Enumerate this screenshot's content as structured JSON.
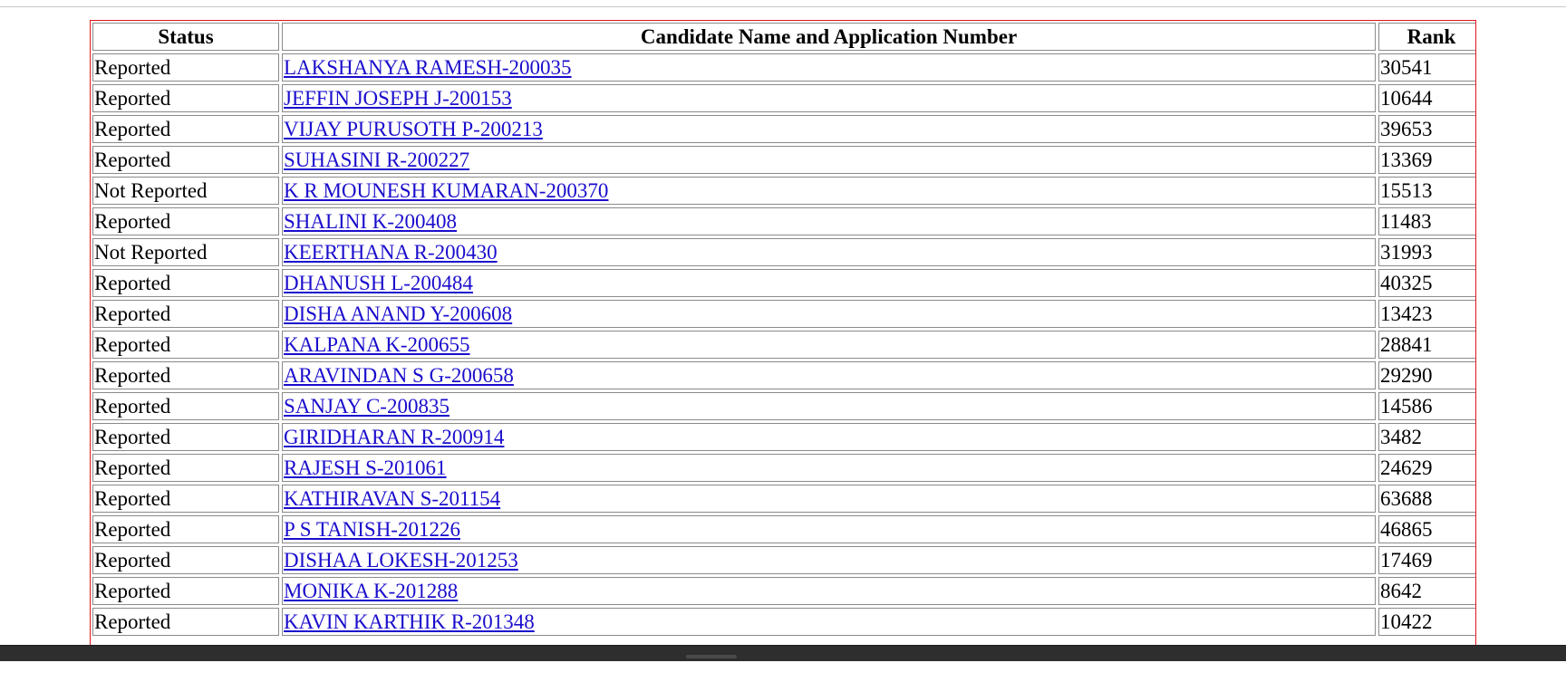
{
  "table": {
    "headers": {
      "status": "Status",
      "candidate": "Candidate Name and Application Number",
      "rank": "Rank"
    },
    "rows": [
      {
        "status": "Reported",
        "candidate": "LAKSHANYA RAMESH-200035",
        "rank": "30541"
      },
      {
        "status": "Reported",
        "candidate": "JEFFIN JOSEPH J-200153",
        "rank": "10644"
      },
      {
        "status": "Reported",
        "candidate": "VIJAY PURUSOTH P-200213",
        "rank": "39653"
      },
      {
        "status": "Reported",
        "candidate": "SUHASINI R-200227",
        "rank": "13369"
      },
      {
        "status": "Not Reported",
        "candidate": "K R MOUNESH KUMARAN-200370",
        "rank": "15513"
      },
      {
        "status": "Reported",
        "candidate": "SHALINI K-200408",
        "rank": "11483"
      },
      {
        "status": "Not Reported",
        "candidate": "KEERTHANA R-200430",
        "rank": "31993"
      },
      {
        "status": "Reported",
        "candidate": "DHANUSH L-200484",
        "rank": "40325"
      },
      {
        "status": "Reported",
        "candidate": "DISHA ANAND Y-200608",
        "rank": "13423"
      },
      {
        "status": "Reported",
        "candidate": "KALPANA K-200655",
        "rank": "28841"
      },
      {
        "status": "Reported",
        "candidate": "ARAVINDAN S G-200658",
        "rank": "29290"
      },
      {
        "status": "Reported",
        "candidate": "SANJAY C-200835",
        "rank": "14586"
      },
      {
        "status": "Reported",
        "candidate": "GIRIDHARAN R-200914",
        "rank": "3482"
      },
      {
        "status": "Reported",
        "candidate": "RAJESH S-201061",
        "rank": "24629"
      },
      {
        "status": "Reported",
        "candidate": "KATHIRAVAN S-201154",
        "rank": "63688"
      },
      {
        "status": "Reported",
        "candidate": "P S TANISH-201226",
        "rank": "46865"
      },
      {
        "status": "Reported",
        "candidate": "DISHAA LOKESH-201253",
        "rank": "17469"
      },
      {
        "status": "Reported",
        "candidate": "MONIKA K-201288",
        "rank": "8642"
      },
      {
        "status": "Reported",
        "candidate": "KAVIN KARTHIK R-201348",
        "rank": "10422"
      }
    ]
  },
  "colors": {
    "frame_border": "#e0161b",
    "link": "#1a0dcc",
    "taskbar": "#2e2e2e"
  }
}
